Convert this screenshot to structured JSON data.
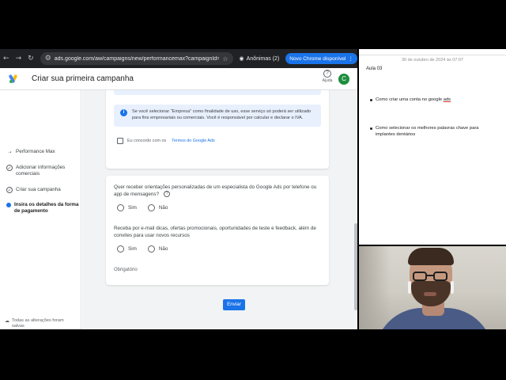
{
  "browser": {
    "url": "ads.google.com/aw/campaigns/new/performancemax?campaignId=28149...",
    "incognito_label": "Anônimas (2)",
    "update_label": "Novo Chrome disponível"
  },
  "header": {
    "title": "Criar sua primeira campanha",
    "help_label": "Ajuda",
    "avatar_letter": "C"
  },
  "sidebar": {
    "steps": [
      {
        "label": "Performance Max"
      },
      {
        "label": "Adicionar informações comerciais"
      },
      {
        "label": "Criar sua campanha"
      },
      {
        "label": "Insira os detalhes da forma de pagamento"
      }
    ],
    "saved_text": "Todas as alterações foram salvas"
  },
  "card1": {
    "info_text": "Se você selecionar \"Empresa\" como finalidade de uso, esse serviço só poderá ser utilizado para fins empresariais ou comerciais. Você é responsável por calcular e declarar o IVA.",
    "terms_text": "Eu concordo com os",
    "terms_link": "Termos do Google Ads"
  },
  "card2": {
    "question1": "Quer receber orientações personalizadas de um especialista do Google Ads por telefone ou app de mensagens?",
    "question2": "Receba por e-mail dicas, ofertas promocionais, oportunidades de teste e feedback, além de convites para usar novos recursos",
    "yes": "Sim",
    "no": "Não",
    "required": "Obrigatório"
  },
  "submit_label": "Enviar",
  "notes": {
    "date": "30 de outubro de 2024 às 07:07",
    "title": "Aula 03",
    "items": [
      {
        "before": "Como criar uma conta no google ",
        "underlined": "ads"
      },
      {
        "before": "Como selecionar os melhores palavras chave para implantes dentários",
        "underlined": ""
      }
    ]
  },
  "colors": {
    "primary": "#1a73e8",
    "avatar": "#1e8e3e",
    "chrome_bar": "#202124"
  }
}
